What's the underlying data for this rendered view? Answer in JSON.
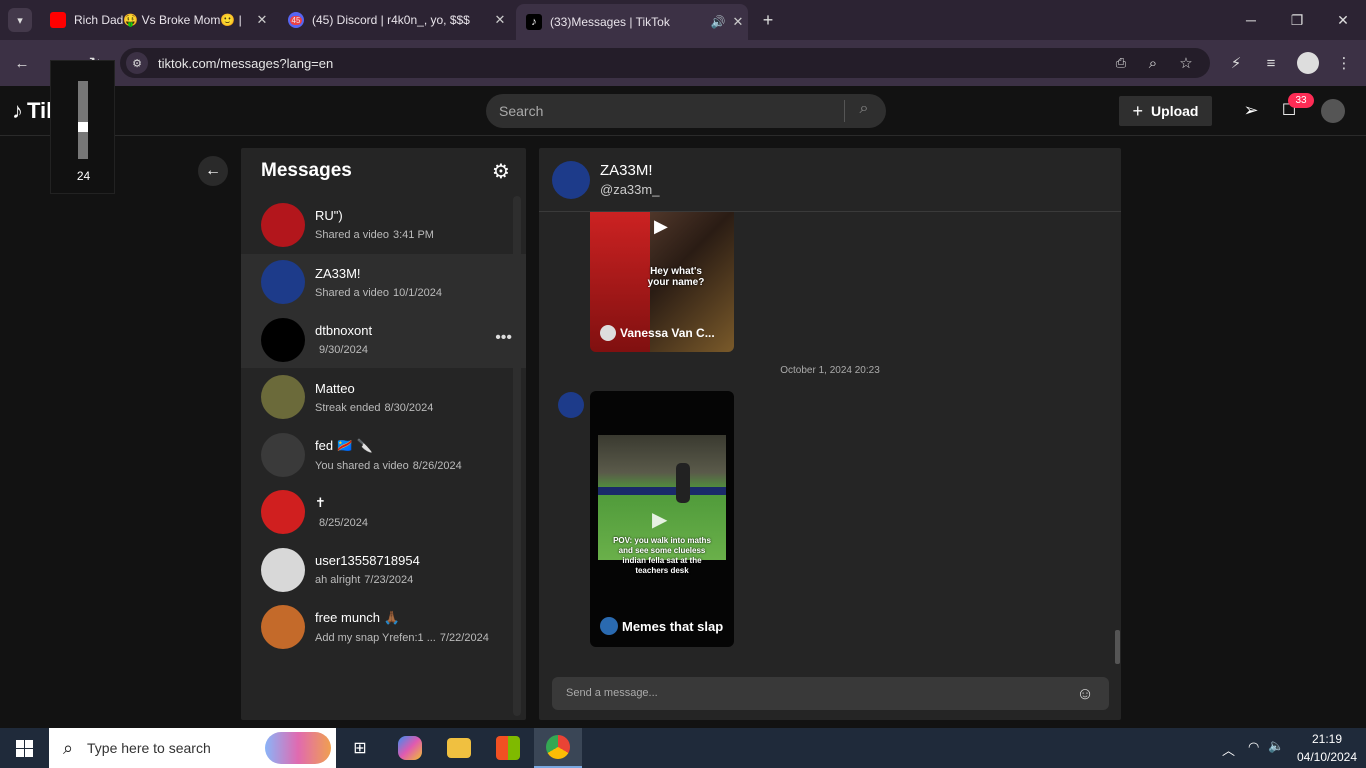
{
  "browser": {
    "tabs": [
      {
        "title": "Rich Dad🤑 Vs Broke Mom🙂 |",
        "icon": "youtube-icon"
      },
      {
        "title": "(45) Discord | r4k0n_, yo, $$$",
        "icon": "discord-icon",
        "badge": "45"
      },
      {
        "title": "(33)Messages | TikTok",
        "icon": "tiktok-icon"
      }
    ],
    "url": "tiktok.com/messages?lang=en"
  },
  "volume_overlay": {
    "level": 24,
    "level_fraction": 0.24
  },
  "tiktok": {
    "logo": "TikTok",
    "search_placeholder": "Search",
    "upload_label": "Upload",
    "inbox_badge": "33"
  },
  "messages": {
    "title": "Messages",
    "conversations": [
      {
        "name": "RU\")",
        "preview": "Shared a video",
        "time": "3:41 PM",
        "avatar_color": "#b3161c"
      },
      {
        "name": "ZA33M!",
        "preview": "Shared a video",
        "time": "10/1/2024",
        "avatar_color": "#1d3b8a"
      },
      {
        "name": "dtbnoxont",
        "preview": "",
        "time": "9/30/2024",
        "avatar_color": "#000000"
      },
      {
        "name": "Matteo",
        "preview": "Streak ended",
        "time": "8/30/2024",
        "avatar_color": "#6b6a3a"
      },
      {
        "name": "fed 🇨🇩 🔪",
        "preview": "You shared a video",
        "time": "8/26/2024",
        "avatar_color": "#3a3a3a"
      },
      {
        "name": "✝",
        "preview": "",
        "time": "8/25/2024",
        "avatar_color": "#d01f1f"
      },
      {
        "name": "user13558718954",
        "preview": "ah alright",
        "time": "7/23/2024",
        "avatar_color": "#d8d8d8"
      },
      {
        "name": "free munch 🙏🏾",
        "preview": "Add my snap Yrefen:1 ...",
        "time": "7/22/2024",
        "avatar_color": "#c46a2a"
      }
    ]
  },
  "chat": {
    "contact_name": "ZA33M!",
    "contact_handle": "@za33m_",
    "video1": {
      "caption": "Hey what's your name?",
      "author": "Vanessa Van C..."
    },
    "divider_time": "October 1, 2024 20:23",
    "video2": {
      "caption": "POV: you walk into maths and see some clueless indian fella sat at the teachers desk",
      "author": "Memes that slap"
    },
    "input_placeholder": "Send a message..."
  },
  "taskbar": {
    "search_placeholder": "Type here to search",
    "time": "21:19",
    "date": "04/10/2024"
  }
}
